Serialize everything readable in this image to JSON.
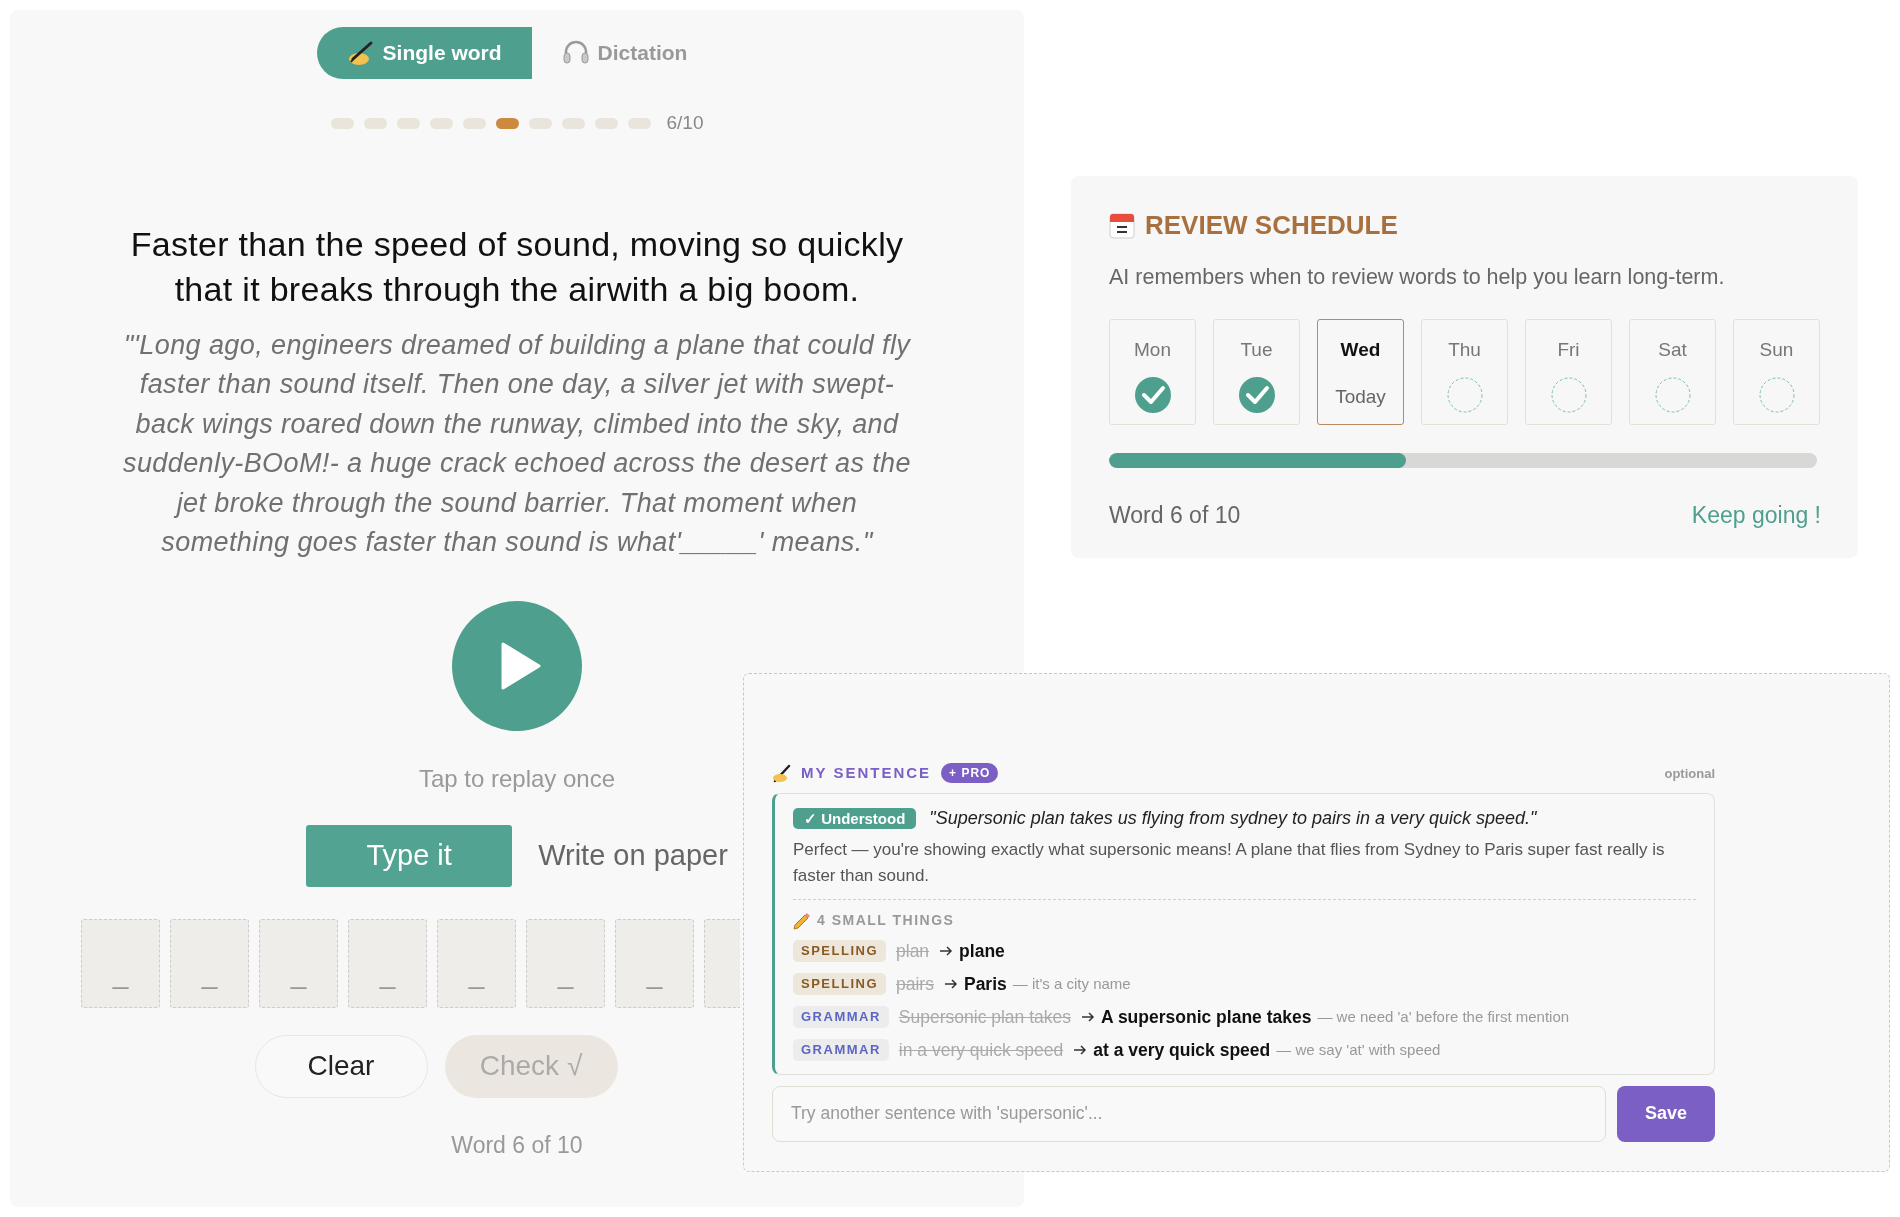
{
  "mode_tabs": [
    {
      "label": "Single word",
      "kind": "write",
      "selected": true
    },
    {
      "label": "Dictation",
      "kind": "listen",
      "selected": false
    }
  ],
  "progress": {
    "dots": [
      {
        "current": false
      },
      {
        "current": false
      },
      {
        "current": false
      },
      {
        "current": false
      },
      {
        "current": false
      },
      {
        "current": true
      },
      {
        "current": false
      },
      {
        "current": false
      },
      {
        "current": false
      },
      {
        "current": false
      }
    ],
    "label": "6/10"
  },
  "definition": "Faster than the speed of sound, moving so quickly that it breaks through the airwith a big boom.",
  "passage": "\"'Long ago, engineers dreamed of building a plane that could fly faster than sound itself. Then one day, a silver jet with swept-back wings roared down the runway, climbed into the sky, and suddenly-BOoM!- a huge crack echoed across the desert as the jet broke through the sound barrier. That moment when something goes faster than sound is what'_____' means.\"",
  "play_hint": "Tap to replay once",
  "answer_modes": [
    {
      "label": "Type it",
      "selected": true
    },
    {
      "label": "Write on paper",
      "selected": false
    }
  ],
  "letter_slots": [
    {
      "placeholder": "_"
    },
    {
      "placeholder": "_"
    },
    {
      "placeholder": "_"
    },
    {
      "placeholder": "_"
    },
    {
      "placeholder": "_"
    },
    {
      "placeholder": "_"
    },
    {
      "placeholder": "_"
    },
    {
      "partial": true
    }
  ],
  "actions": [
    {
      "label": "Clear",
      "disabled": false
    },
    {
      "label": "Check √",
      "disabled": true
    }
  ],
  "footer": "Word 6 of 10",
  "review": {
    "title": "REVIEW SCHEDULE",
    "subtitle": "AI remembers when to review words to help you learn long-term.",
    "days": [
      {
        "label": "Mon",
        "done": true,
        "today": false
      },
      {
        "label": "Tue",
        "done": true,
        "today": false
      },
      {
        "label": "Wed",
        "done": false,
        "today": true,
        "note": "Today"
      },
      {
        "label": "Thu",
        "done": false,
        "today": false
      },
      {
        "label": "Fri",
        "done": false,
        "today": false
      },
      {
        "label": "Sat",
        "done": false,
        "today": false
      },
      {
        "label": "Sun",
        "done": false,
        "today": false
      }
    ],
    "level": 0.42,
    "progress_label": "Word 6 of 10",
    "encouragement": "Keep going !"
  },
  "sentence": {
    "title": "MY SENTENCE",
    "badge": "+ PRO",
    "optional": "optional",
    "verdict": "✓ Understood",
    "quote": "\"Supersonic plan takes us flying from sydney to pairs in a very quick speed.\"",
    "message": "Perfect — you're showing exactly what supersonic means! A plane that flies from Sydney to Paris super fast really is faster than sound.",
    "corrections_title": "4 SMALL THINGS",
    "corrections": [
      {
        "kind": "spelling",
        "tag": "SPELLING",
        "wrong": "plan",
        "right": "plane"
      },
      {
        "kind": "spelling",
        "tag": "SPELLING",
        "wrong": "pairs",
        "right": "Paris",
        "note": "— it's a city name"
      },
      {
        "kind": "grammar",
        "tag": "GRAMMAR",
        "wrong": "Supersonic plan takes",
        "right": "A supersonic plane takes",
        "note": "— we need 'a' before the first mention"
      },
      {
        "kind": "grammar",
        "tag": "GRAMMAR",
        "wrong": "in a very quick speed",
        "right": "at a very quick speed",
        "note": "— we say 'at' with speed"
      }
    ],
    "input_placeholder": "Try another sentence with 'supersonic'...",
    "save": "Save"
  }
}
